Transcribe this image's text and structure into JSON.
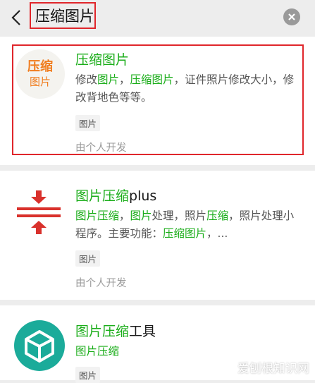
{
  "search": {
    "query": "压缩图片"
  },
  "results": [
    {
      "icon": {
        "line1": "压缩",
        "line2": "图片"
      },
      "title": "压缩图片",
      "desc": {
        "p1": "修改",
        "h1": "图片",
        "p2": "，",
        "h2": "压缩图片",
        "p3": "，证件照片修改大小，修改背地色等等。"
      },
      "tag": "图片",
      "developer": "由个人开发"
    },
    {
      "title_highlight": "图片压缩",
      "title_rest": "plus",
      "desc": {
        "h1": "图片压缩",
        "p1": "，",
        "h2": "图片",
        "p2": "处理，照片",
        "h3": "压缩",
        "p3": "，照片处理小程序。主要功能：",
        "h4": "压缩图片",
        "p4": "，..."
      },
      "tag": "图片",
      "developer": "由个人开发"
    },
    {
      "title_highlight": "图片压缩",
      "title_rest": "工具",
      "desc_highlight": "图片压缩",
      "tag": "图片"
    }
  ],
  "watermark": "爱刨根知识网",
  "colors": {
    "highlight_red": "#e0262b",
    "keyword_green": "#1aad19",
    "icon_orange": "#f07d1f",
    "icon_teal": "#1bab9a"
  }
}
